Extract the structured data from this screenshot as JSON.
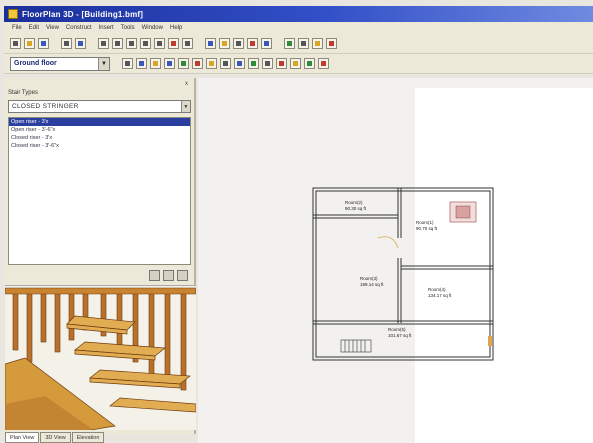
{
  "window": {
    "title": "FloorPlan 3D - [Building1.bmf]"
  },
  "menu": [
    "File",
    "Edit",
    "View",
    "Construct",
    "Insert",
    "Tools",
    "Window",
    "Help"
  ],
  "toolbar2": {
    "floor_select": "Ground floor"
  },
  "panel": {
    "close_glyph": "x",
    "label": "Stair Types",
    "stair_type": "CLOSED STRINGER",
    "items": [
      "Open riser - 3'x",
      "Open riser - 3'-6\"x",
      "Closed riser - 3'x",
      "Closed riser - 3'-6\"x"
    ],
    "selected_index": 0
  },
  "tabs": [
    "Plan View",
    "3D View",
    "Elevation"
  ],
  "active_tab": 0,
  "plan": {
    "rooms": [
      {
        "name": "Room(2)",
        "area": "90.30 sq ft"
      },
      {
        "name": "Room(1)",
        "area": "90.70 sq ft"
      },
      {
        "name": "Room(3)",
        "area": "189.14 sq ft"
      },
      {
        "name": "Room(4)",
        "area": "134.17 sq ft"
      },
      {
        "name": "Room(5)",
        "area": "101.67 sq ft"
      }
    ]
  },
  "colors": {
    "title_bar": "#1a2f9a",
    "selection": "#2b3fa0",
    "stair_wood": "#d49a3c"
  }
}
